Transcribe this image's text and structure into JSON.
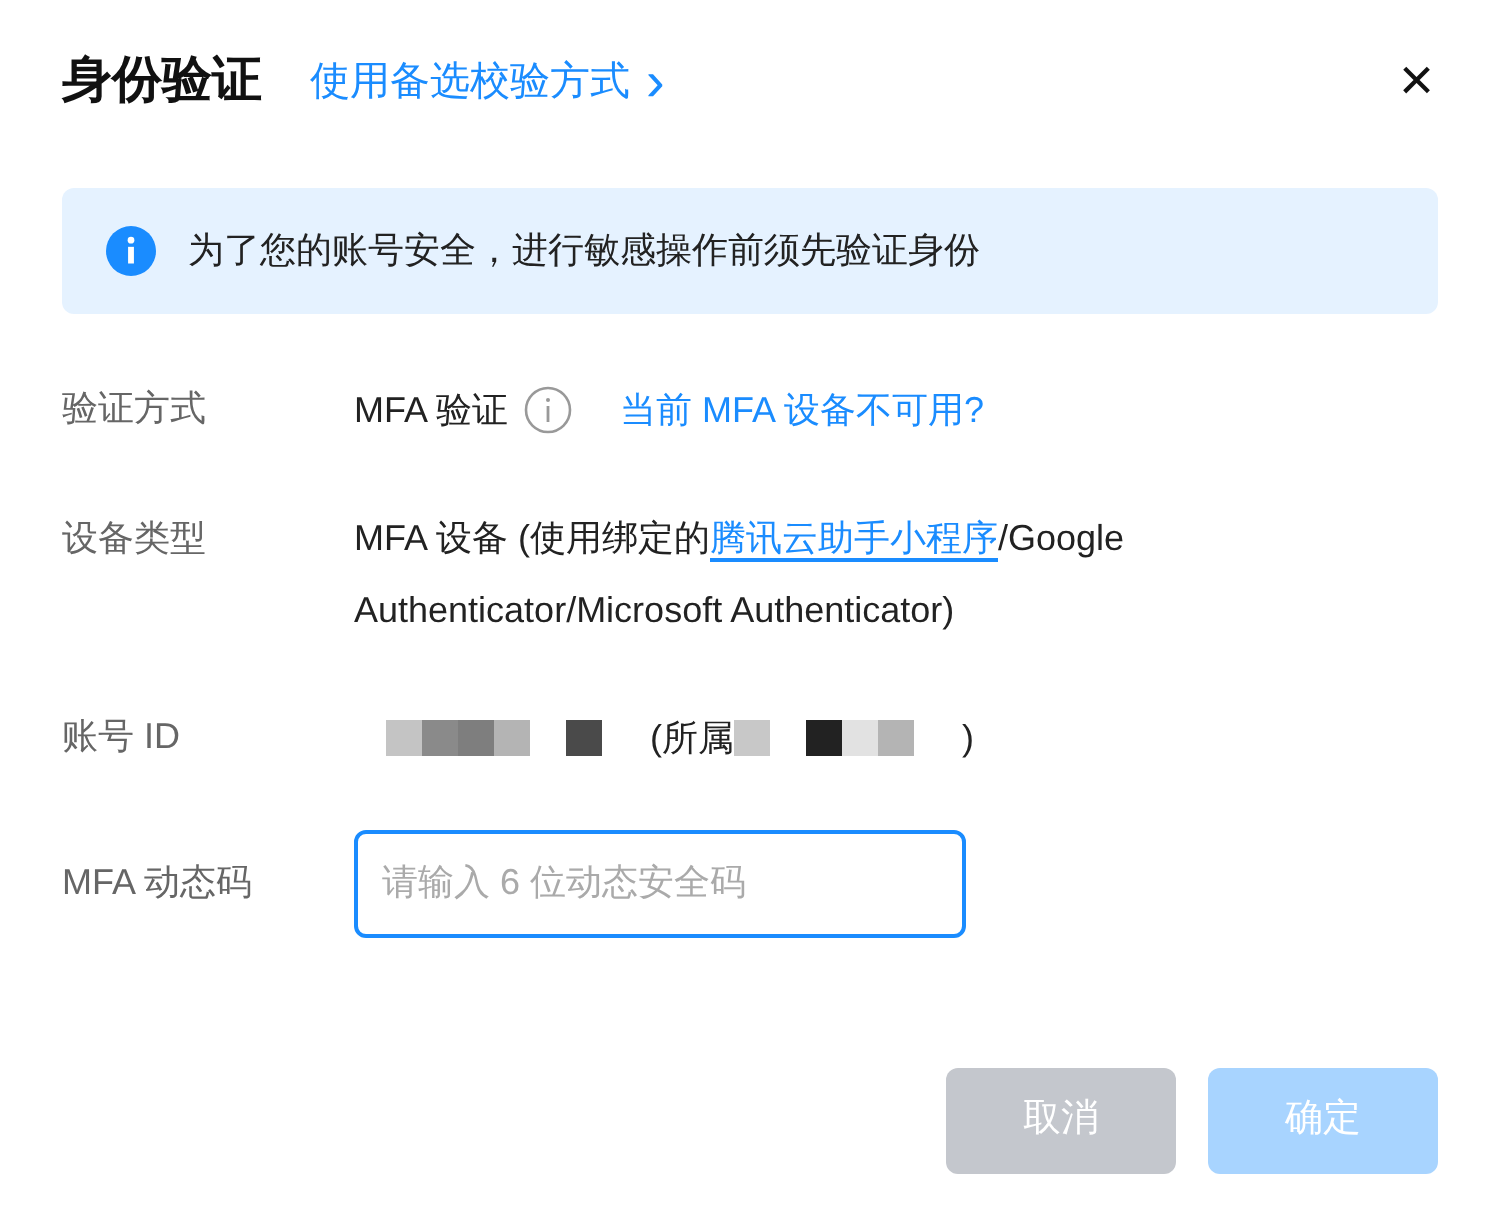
{
  "dialog": {
    "title": "身份验证",
    "alt_link": "使用备选校验方式",
    "alt_link_icon": "›",
    "close": "×"
  },
  "alert": {
    "text": "为了您的账号安全，进行敏感操作前须先验证身份"
  },
  "fields": [
    {
      "kind": "method",
      "label": "验证方式",
      "value": "MFA 验证",
      "link": "当前 MFA 设备不可用?"
    },
    {
      "kind": "device",
      "label": "设备类型",
      "before": "MFA 设备 (使用绑定的",
      "link": "腾讯云助手小程序",
      "after": "/Google Authenticator/Microsoft Authenticator)"
    },
    {
      "kind": "account",
      "label": "账号 ID",
      "prefix": "(所属",
      "suffix": ")"
    },
    {
      "kind": "input",
      "label": "MFA 动态码",
      "placeholder": "请输入 6 位动态安全码"
    }
  ],
  "buttons": [
    {
      "label": "取消",
      "kind": "secondary",
      "disabled": true
    },
    {
      "label": "确定",
      "kind": "primary",
      "disabled": true
    }
  ]
}
